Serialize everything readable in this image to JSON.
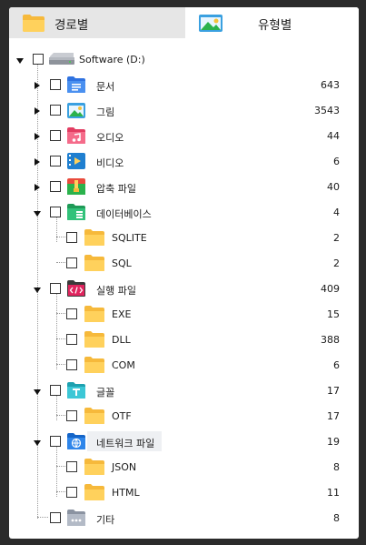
{
  "tabs": [
    {
      "label": "경로별",
      "icon": "folder-icon",
      "active": false
    },
    {
      "label": "유형별",
      "icon": "image-icon",
      "active": true
    }
  ],
  "tree": {
    "root": {
      "label": "Software (D:)",
      "icon": "drive-icon",
      "expanded": true
    },
    "items": [
      {
        "label": "문서",
        "count": "643",
        "icon": "document-folder-icon",
        "color": "#3b82f6",
        "expanded": false
      },
      {
        "label": "그림",
        "count": "3543",
        "icon": "picture-folder-icon",
        "color": "#3aa0e0",
        "expanded": false
      },
      {
        "label": "오디오",
        "count": "44",
        "icon": "audio-folder-icon",
        "color": "#f05a78",
        "expanded": false
      },
      {
        "label": "비디오",
        "count": "6",
        "icon": "video-folder-icon",
        "color": "#2b8fd6",
        "expanded": false
      },
      {
        "label": "압축 파일",
        "count": "40",
        "icon": "archive-folder-icon",
        "color": "#2bb24c",
        "expanded": false
      },
      {
        "label": "데이터베이스",
        "count": "4",
        "icon": "database-folder-icon",
        "color": "#27b36a",
        "expanded": true,
        "children": [
          {
            "label": "SQLITE",
            "count": "2"
          },
          {
            "label": "SQL",
            "count": "2"
          }
        ]
      },
      {
        "label": "실행 파일",
        "count": "409",
        "icon": "executable-folder-icon",
        "color": "#e0245e",
        "expanded": true,
        "children": [
          {
            "label": "EXE",
            "count": "15"
          },
          {
            "label": "DLL",
            "count": "388"
          },
          {
            "label": "COM",
            "count": "6"
          }
        ]
      },
      {
        "label": "글꼴",
        "count": "17",
        "icon": "font-folder-icon",
        "color": "#28b8c8",
        "expanded": true,
        "children": [
          {
            "label": "OTF",
            "count": "17"
          }
        ]
      },
      {
        "label": "네트워크 파일",
        "count": "19",
        "icon": "network-folder-icon",
        "color": "#1e73d8",
        "expanded": true,
        "children": [
          {
            "label": "JSON",
            "count": "8"
          },
          {
            "label": "HTML",
            "count": "11"
          }
        ]
      },
      {
        "label": "기타",
        "count": "8",
        "icon": "other-folder-icon",
        "color": "#9aa3b2",
        "expanded": false
      }
    ]
  }
}
